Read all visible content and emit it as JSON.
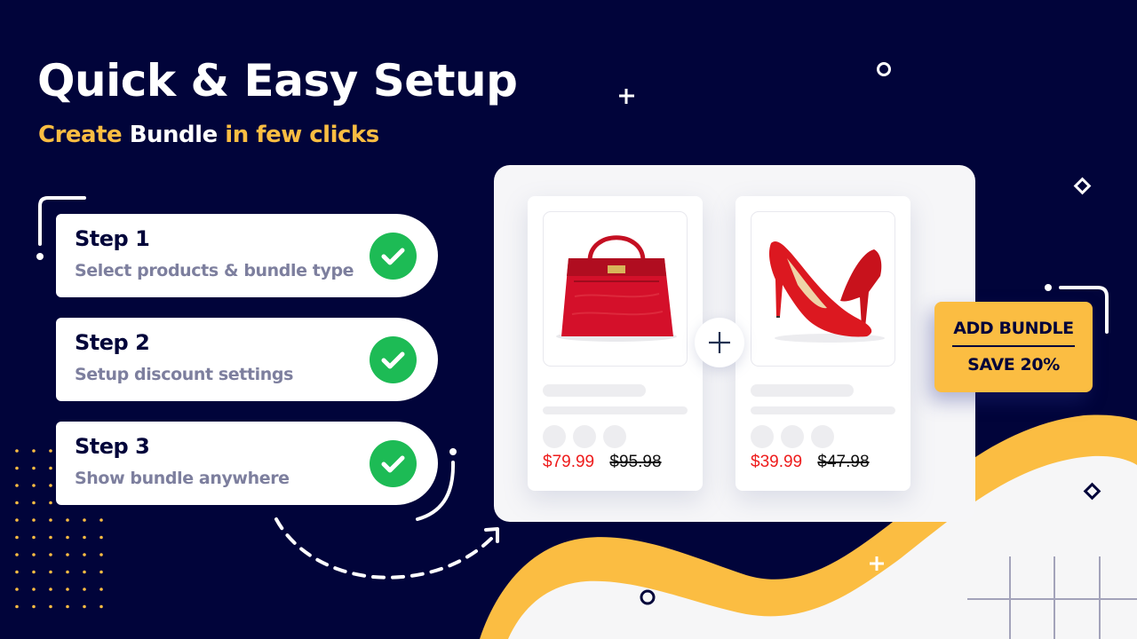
{
  "headline": {
    "title": "Quick & Easy Setup",
    "subtitle": {
      "part1": "Create",
      "part2": "Bundle",
      "part3": "in few clicks"
    }
  },
  "steps": [
    {
      "title": "Step 1",
      "description": "Select products & bundle type",
      "status": "completed",
      "status_icon": "check-circle-icon"
    },
    {
      "title": "Step 2",
      "description": "Setup discount settings",
      "status": "completed",
      "status_icon": "check-circle-icon"
    },
    {
      "title": "Step 3",
      "description": "Show bundle anywhere",
      "status": "completed",
      "status_icon": "check-circle-icon"
    }
  ],
  "bundle_preview": {
    "products": [
      {
        "image": "red-handbag",
        "sale_price": "$79.99",
        "original_price": "$95.98"
      },
      {
        "image": "red-high-heels",
        "sale_price": "$39.99",
        "original_price": "$47.98"
      }
    ],
    "combine_icon": "plus-icon"
  },
  "badge": {
    "line1": "ADD BUNDLE",
    "line2": "SAVE 20%"
  },
  "colors": {
    "background": "#01043a",
    "accent_yellow": "#fbbd42",
    "check_green": "#1dbb55",
    "sale_red": "#ee1c1c",
    "panel_gray": "#f6f6f8",
    "muted_text": "#7d7f9e"
  }
}
